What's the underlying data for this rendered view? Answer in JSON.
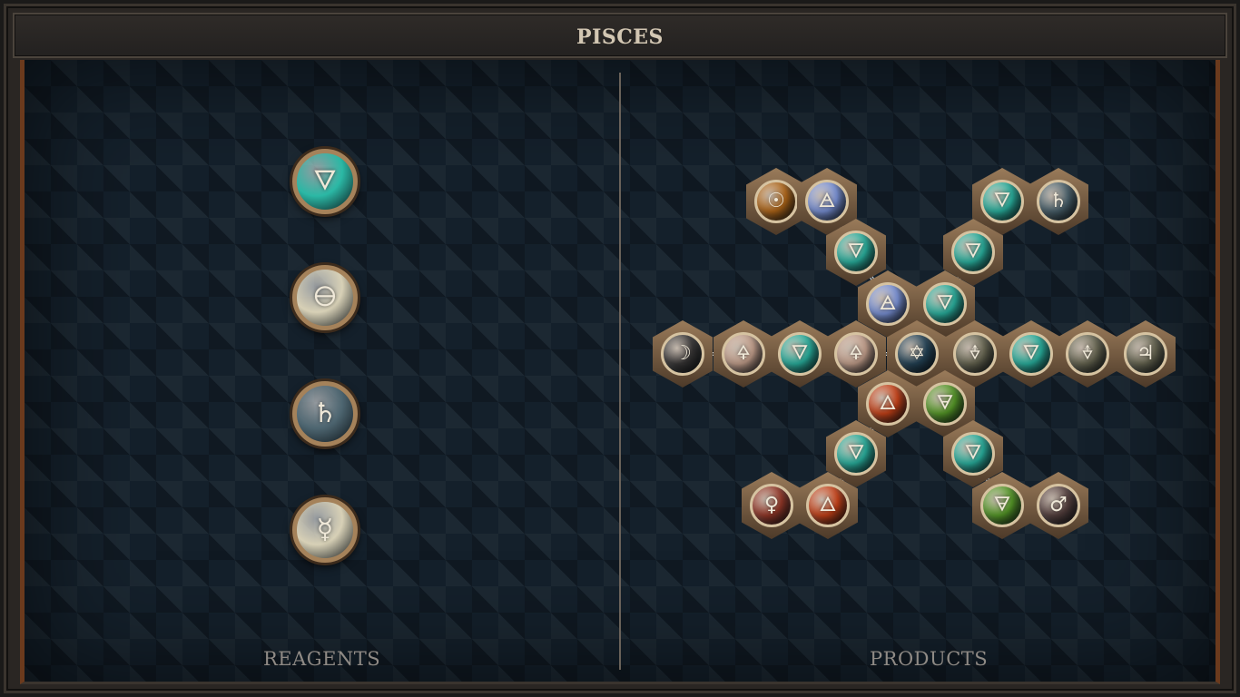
{
  "title": "PISCES",
  "labels": {
    "reagents": "REAGENTS",
    "products": "PRODUCTS"
  },
  "colors": {
    "water": "#2bb8a5",
    "air": "#7f98e0",
    "fire": "#d0451a",
    "earth": "#5aa02a",
    "salt": "#d7d0b6",
    "quicksilver": "#d7d0b6",
    "lead": "#4d6570",
    "gold": "#b86b1a",
    "silver": "#3a3838",
    "copper": "#9a3a2a",
    "iron": "#5a4442",
    "tin": "#6b6a55",
    "vitae": "#caa591",
    "mors": "#6b6a55",
    "quintessence": "#26465a"
  },
  "reagents": [
    {
      "element": "water",
      "glyph": "🜄"
    },
    {
      "element": "salt",
      "glyph": "🜔"
    },
    {
      "element": "lead",
      "glyph": "♄"
    },
    {
      "element": "quicksilver",
      "glyph": "☿"
    }
  ],
  "products": [
    {
      "element": "gold",
      "glyph": "☉"
    },
    {
      "element": "air",
      "glyph": "🜁"
    },
    {
      "element": "water",
      "glyph": "🜄"
    },
    {
      "element": "air",
      "glyph": "🜁"
    },
    {
      "element": "water",
      "glyph": "🜄"
    },
    {
      "element": "lead",
      "glyph": "♄"
    },
    {
      "element": "water",
      "glyph": "🜄"
    },
    {
      "element": "water",
      "glyph": "🜄"
    },
    {
      "element": "silver",
      "glyph": "☽"
    },
    {
      "element": "vitae",
      "glyph": "🜍"
    },
    {
      "element": "water",
      "glyph": "🜄"
    },
    {
      "element": "vitae",
      "glyph": "🜍"
    },
    {
      "element": "quintessence",
      "glyph": "✡"
    },
    {
      "element": "mors",
      "glyph": "🜞"
    },
    {
      "element": "water",
      "glyph": "🜄"
    },
    {
      "element": "mors",
      "glyph": "🜞"
    },
    {
      "element": "tin",
      "glyph": "♃"
    },
    {
      "element": "fire",
      "glyph": "🜂"
    },
    {
      "element": "earth",
      "glyph": "🜃"
    },
    {
      "element": "water",
      "glyph": "🜄"
    },
    {
      "element": "water",
      "glyph": "🜄"
    },
    {
      "element": "copper",
      "glyph": "♀"
    },
    {
      "element": "fire",
      "glyph": "🜂"
    },
    {
      "element": "earth",
      "glyph": "🜃"
    },
    {
      "element": "iron",
      "glyph": "♂"
    }
  ]
}
